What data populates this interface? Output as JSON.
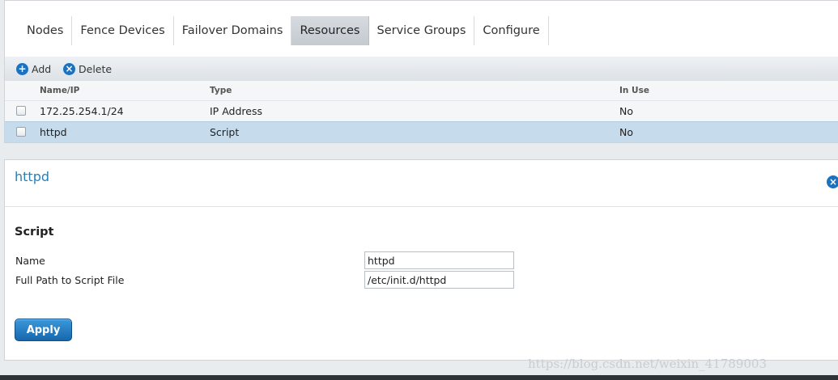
{
  "nav": {
    "tabs": [
      {
        "label": "Nodes"
      },
      {
        "label": "Fence Devices"
      },
      {
        "label": "Failover Domains"
      },
      {
        "label": "Resources"
      },
      {
        "label": "Service Groups"
      },
      {
        "label": "Configure"
      }
    ],
    "active_tab": "Resources"
  },
  "toolbar": {
    "add_label": "Add",
    "add_icon": "plus-circle-icon",
    "delete_label": "Delete",
    "delete_icon": "x-circle-icon"
  },
  "table": {
    "columns": [
      "Name/IP",
      "Type",
      "In Use"
    ],
    "rows": [
      {
        "name": "172.25.254.1/24",
        "type": "IP Address",
        "in_use": "No",
        "selected": false
      },
      {
        "name": "httpd",
        "type": "Script",
        "in_use": "No",
        "selected": true
      }
    ]
  },
  "detail": {
    "title": "httpd",
    "section": "Script",
    "fields": [
      {
        "label": "Name",
        "value": "httpd"
      },
      {
        "label": "Full Path to Script File",
        "value": "/etc/init.d/httpd"
      }
    ],
    "apply_label": "Apply"
  },
  "watermark": "https://blog.csdn.net/weixin_41789003",
  "colors": {
    "accent": "#1a73c0",
    "selected_row": "#c6dcec",
    "title_link": "#2a7fb5"
  }
}
